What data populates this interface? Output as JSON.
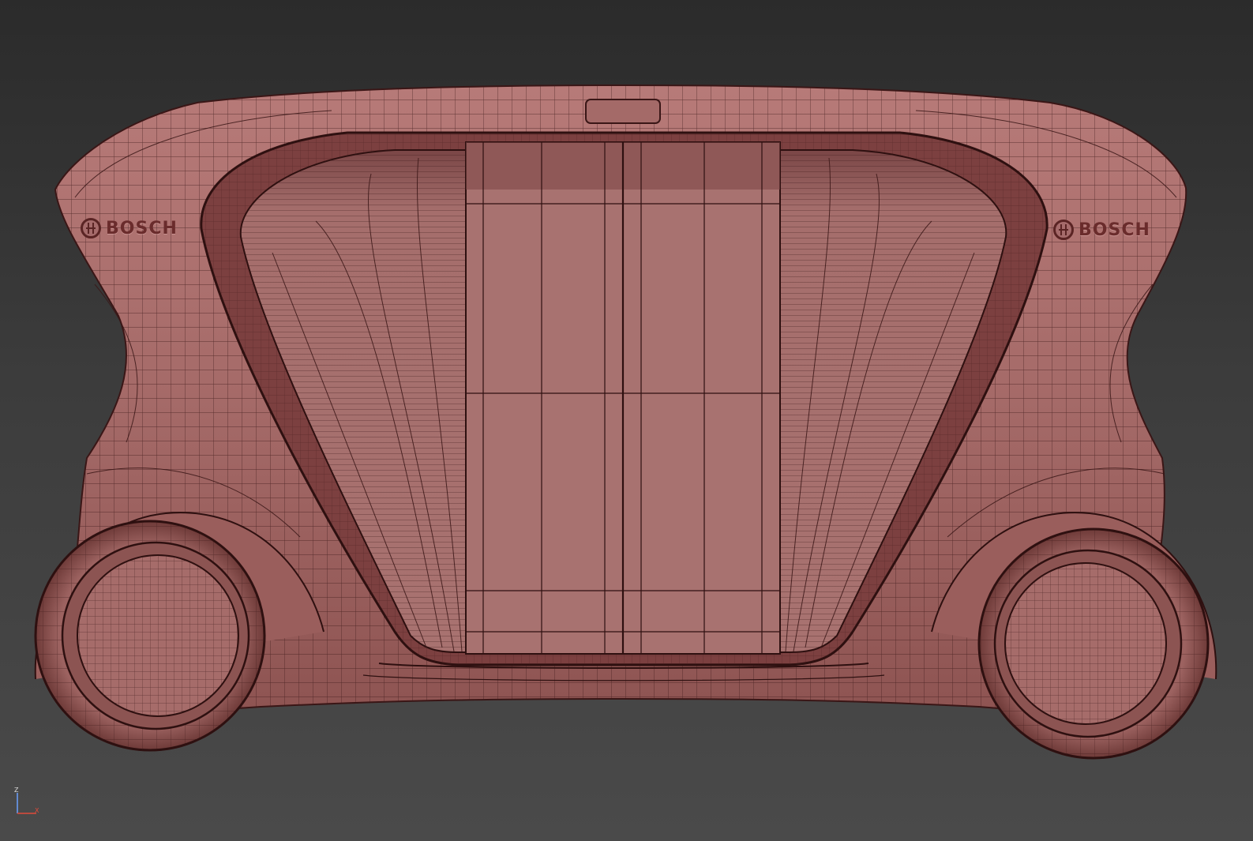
{
  "viewport": {
    "background": "#3a3a3a",
    "model_color": "#a86e6e",
    "wire_color": "#3a1616"
  },
  "brand_left": {
    "text": "BOSCH",
    "icon": "bosch-logo-icon"
  },
  "brand_right": {
    "text": "BOSCH",
    "icon": "bosch-logo-icon"
  },
  "axis_gizmo": {
    "z_label": "Z",
    "x_label": "X",
    "z_color": "#6aa0ff",
    "x_color": "#e04a3a"
  }
}
